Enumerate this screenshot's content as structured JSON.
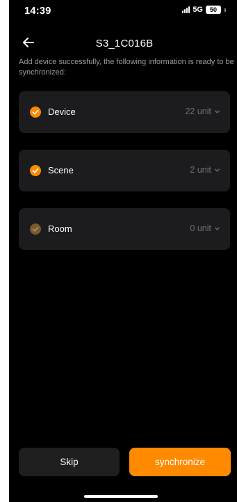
{
  "status_bar": {
    "time": "14:39",
    "network": "5G",
    "battery": "50"
  },
  "header": {
    "title": "S3_1C016B",
    "back_icon": "arrow-left-icon"
  },
  "message": "Add device successfully, the following information is ready to be synchronized:",
  "items": [
    {
      "label": "Device",
      "count": "22 unit",
      "checked": true,
      "check_color": "#ff8a00"
    },
    {
      "label": "Scene",
      "count": "2 unit",
      "checked": true,
      "check_color": "#ff8a00"
    },
    {
      "label": "Room",
      "count": "0 unit",
      "checked": true,
      "check_color": "#7a5a2b"
    }
  ],
  "buttons": {
    "skip": "Skip",
    "synchronize": "synchronize"
  },
  "colors": {
    "accent": "#ff8a00",
    "background": "#000000",
    "card": "#1c1c1e",
    "muted_text": "#9b9b9b"
  }
}
